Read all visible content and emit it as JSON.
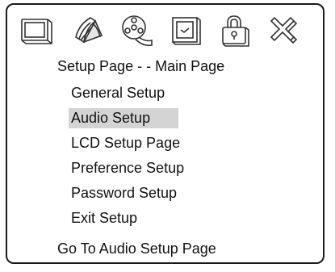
{
  "toolbar": {
    "icons": [
      "tv-icon",
      "speaker-icon",
      "film-reel-icon",
      "lcd-screen-icon",
      "lock-icon",
      "exit-x-icon"
    ]
  },
  "header": {
    "title": "Setup Page - - Main Page"
  },
  "menu": {
    "items": [
      {
        "label": "General Setup",
        "selected": false
      },
      {
        "label": "Audio Setup",
        "selected": true
      },
      {
        "label": "LCD Setup Page",
        "selected": false
      },
      {
        "label": "Preference Setup",
        "selected": false
      },
      {
        "label": "Password Setup",
        "selected": false
      },
      {
        "label": "Exit Setup",
        "selected": false
      }
    ]
  },
  "status": {
    "text": "Go To Audio Setup Page"
  },
  "colors": {
    "highlight": "#d4d4d4",
    "line": "#333333"
  }
}
